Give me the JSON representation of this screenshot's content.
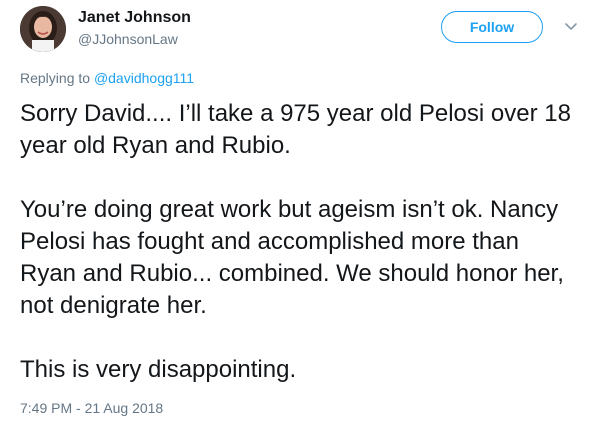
{
  "author": {
    "display_name": "Janet Johnson",
    "handle": "@JJohnsonLaw"
  },
  "header": {
    "follow_label": "Follow",
    "menu_icon": "chevron-down-icon"
  },
  "reply": {
    "prefix": "Replying to ",
    "mention": "@davidhogg111"
  },
  "tweet": {
    "paragraphs": [
      "Sorry David.... I’ll take a 975 year old Pelosi over 18 year old Ryan and Rubio.",
      "You’re doing great work but ageism isn’t ok. Nancy Pelosi has fought and accomplished more than Ryan and Rubio... combined. We should honor her, not denigrate her.",
      "This is very disappointing."
    ],
    "timestamp": "7:49 PM - 21 Aug 2018"
  },
  "colors": {
    "accent": "#1da1f2",
    "text_primary": "#14171a",
    "text_secondary": "#657786"
  }
}
